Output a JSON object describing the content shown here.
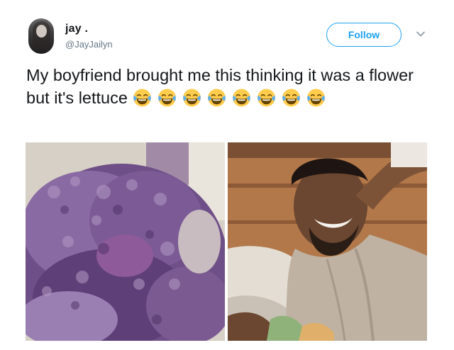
{
  "author": {
    "display_name": "jay .",
    "handle": "@JayJailyn"
  },
  "follow_label": "Follow",
  "tweet": {
    "text": "My boyfriend brought me this thinking it was a flower but it's lettuce",
    "emoji_icon": "face-with-tears-of-joy",
    "emoji_count": 8
  },
  "colors": {
    "accent": "#1da1f2",
    "handle": "#657786",
    "text": "#14171a"
  },
  "media": [
    {
      "icon": "purple-kale-photo"
    },
    {
      "icon": "smiling-man-photo"
    }
  ]
}
